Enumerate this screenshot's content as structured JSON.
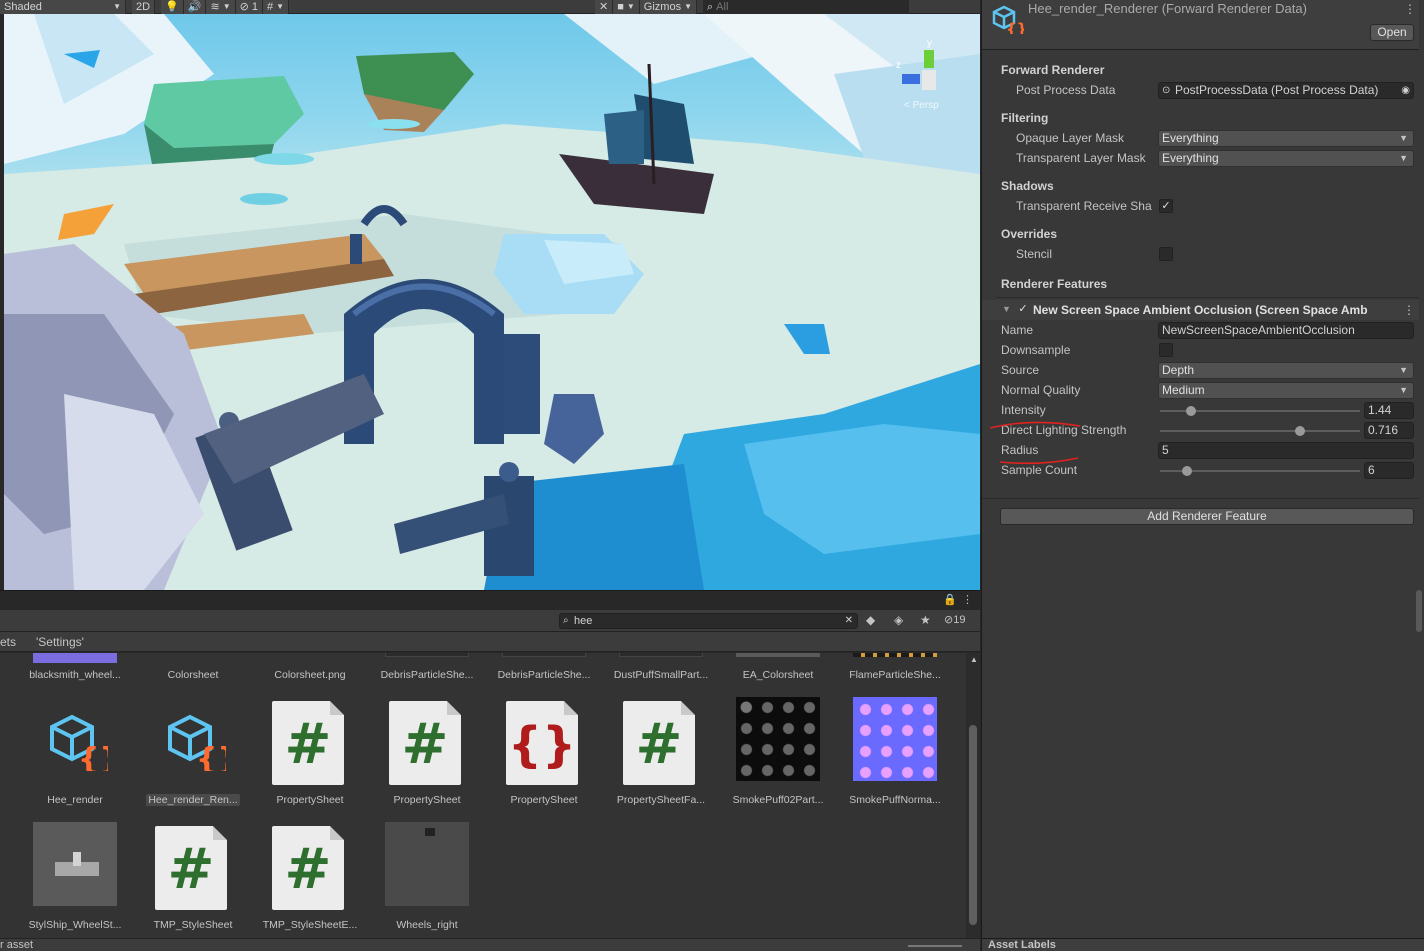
{
  "scene_toolbar": {
    "shading_mode": "Shaded",
    "mode_2d": "2D",
    "hidden_count": "1",
    "gizmos": "Gizmos",
    "search_placeholder": "All"
  },
  "scene_gizmo": {
    "axis_y": "y",
    "axis_z": "z",
    "persp": "< Persp"
  },
  "project": {
    "search_value": "hee",
    "hidden_count": "19",
    "breadcrumb_partial": "ets",
    "breadcrumb_folder": "'Settings'",
    "row1": [
      "blacksmith_wheel...",
      "Colorsheet",
      "Colorsheet.png",
      "DebrisParticleShe...",
      "DebrisParticleShe...",
      "DustPuffSmallPart...",
      "EA_Colorsheet",
      "FlameParticleShe..."
    ],
    "row2": [
      "Hee_render",
      "Hee_render_Ren...",
      "PropertySheet",
      "PropertySheet",
      "PropertySheet",
      "PropertySheetFa...",
      "SmokePuff02Part...",
      "SmokePuffNorma..."
    ],
    "row3": [
      "StylShip_WheelSt...",
      "TMP_StyleSheet",
      "TMP_StyleSheetE...",
      "Wheels_right"
    ],
    "bottom_status": "r asset"
  },
  "inspector": {
    "title": "Hee_render_Renderer (Forward Renderer Data)",
    "open_label": "Open",
    "sections": {
      "forward": "Forward Renderer",
      "filtering": "Filtering",
      "shadows": "Shadows",
      "overrides": "Overrides",
      "features": "Renderer Features"
    },
    "post_process_label": "Post Process Data",
    "post_process_value": "PostProcessData (Post Process Data)",
    "opaque_label": "Opaque Layer Mask",
    "opaque_value": "Everything",
    "transparent_label": "Transparent Layer Mask",
    "transparent_value": "Everything",
    "transparent_shadow_label": "Transparent Receive Sha",
    "stencil_label": "Stencil",
    "feature_title": "New Screen Space Ambient Occlusion (Screen Space Amb",
    "name_label": "Name",
    "name_value": "NewScreenSpaceAmbientOcclusion",
    "downsample_label": "Downsample",
    "source_label": "Source",
    "source_value": "Depth",
    "normal_quality_label": "Normal Quality",
    "normal_quality_value": "Medium",
    "intensity_label": "Intensity",
    "intensity_value": "1.44",
    "direct_label": "Direct Lighting Strength",
    "direct_value": "0.716",
    "radius_label": "Radius",
    "radius_value": "5",
    "sample_label": "Sample Count",
    "sample_value": "6",
    "add_feature_label": "Add Renderer Feature",
    "footer_label": "Asset Labels"
  },
  "colors": {
    "accent_json_icon": "#ff6a2e",
    "asset_icon_blue": "#5ec4f0",
    "annotation_red": "#e0231f",
    "hash_green": "#2e6e2e"
  }
}
